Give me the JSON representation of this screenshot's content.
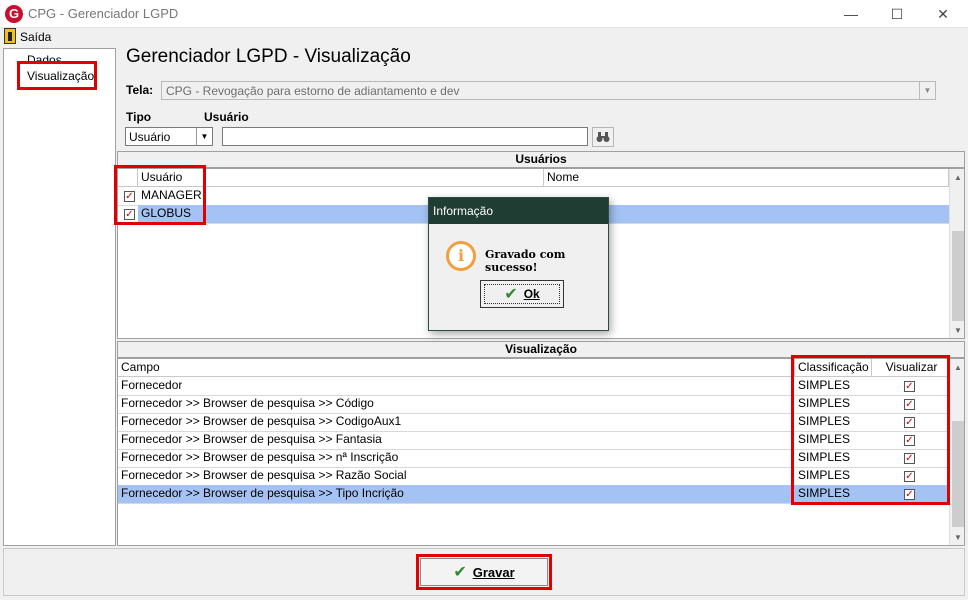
{
  "window": {
    "title": "CPG - Gerenciador LGPD",
    "logo_letter": "G"
  },
  "menu": {
    "exit_label": "Saída"
  },
  "sidebar": {
    "items": [
      {
        "label": "Dados"
      },
      {
        "label": "Visualização"
      }
    ]
  },
  "page": {
    "title": "Gerenciador LGPD - Visualização"
  },
  "form": {
    "screen_label": "Tela:",
    "screen_value": "CPG - Revogação para estorno de adiantamento e dev",
    "type_label": "Tipo",
    "type_value": "Usuário",
    "user_label": "Usuário",
    "user_value": ""
  },
  "users_section": {
    "title": "Usuários",
    "columns": [
      "Usuário",
      "Nome"
    ],
    "rows": [
      {
        "user": "MANAGER",
        "name": "",
        "checked": true
      },
      {
        "user": "GLOBUS",
        "name": "",
        "checked": true,
        "selected": true
      }
    ]
  },
  "view_section": {
    "title": "Visualização",
    "columns": [
      "Campo",
      "Classificação",
      "Visualizar"
    ],
    "rows": [
      {
        "field": "Fornecedor",
        "class": "SIMPLES",
        "visible": true
      },
      {
        "field": "Fornecedor >> Browser de pesquisa >> Código",
        "class": "SIMPLES",
        "visible": true
      },
      {
        "field": "Fornecedor >> Browser de pesquisa >> CodigoAux1",
        "class": "SIMPLES",
        "visible": true
      },
      {
        "field": "Fornecedor >> Browser de pesquisa >> Fantasia",
        "class": "SIMPLES",
        "visible": true
      },
      {
        "field": "Fornecedor >> Browser de pesquisa >> nª Inscrição",
        "class": "SIMPLES",
        "visible": true
      },
      {
        "field": "Fornecedor >> Browser de pesquisa >> Razão Social",
        "class": "SIMPLES",
        "visible": true
      },
      {
        "field": "Fornecedor >> Browser de pesquisa >> Tipo Incrição",
        "class": "SIMPLES",
        "visible": true,
        "selected": true
      }
    ]
  },
  "dialog": {
    "title": "Informação",
    "message": "Gravado com sucesso!",
    "ok_label": "Ok"
  },
  "footer": {
    "save_label": "Gravar"
  },
  "colors": {
    "highlight": "#e00000",
    "selection": "#a4c2f4",
    "dialog_title": "#1f3d33"
  }
}
